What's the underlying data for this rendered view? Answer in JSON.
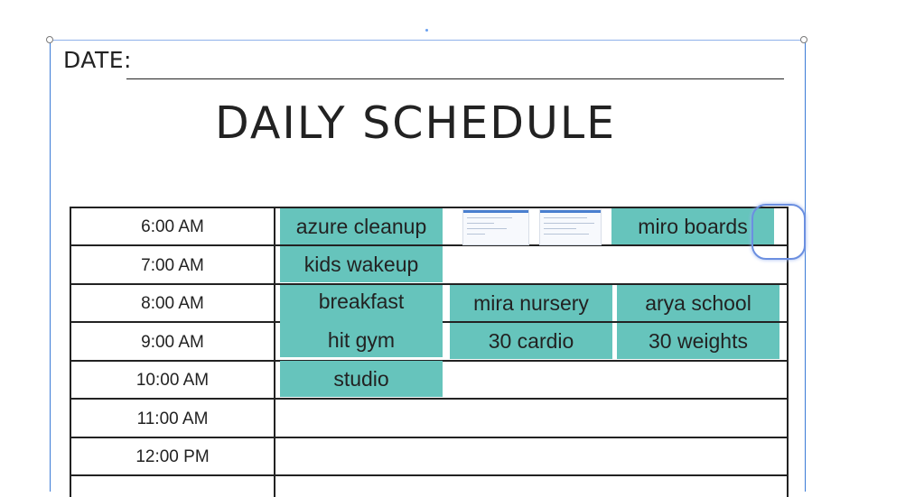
{
  "page": {
    "date_label": "DATE:",
    "title": "DAILY SCHEDULE"
  },
  "times": [
    "6:00 AM",
    "7:00 AM",
    "8:00 AM",
    "9:00 AM",
    "10:00 AM",
    "11:00 AM",
    "12:00 PM"
  ],
  "events": {
    "azure_cleanup": "azure cleanup",
    "miro_boards": "miro boards",
    "kids_wakeup": "kids wakeup",
    "breakfast": "breakfast",
    "mira_nursery": "mira nursery",
    "arya_school": "arya school",
    "hit_gym": "hit gym",
    "cardio": "30 cardio",
    "weights": "30 weights",
    "studio": "studio"
  },
  "colors": {
    "event_fill": "#66c4bc",
    "selection": "#3b7bd6"
  }
}
